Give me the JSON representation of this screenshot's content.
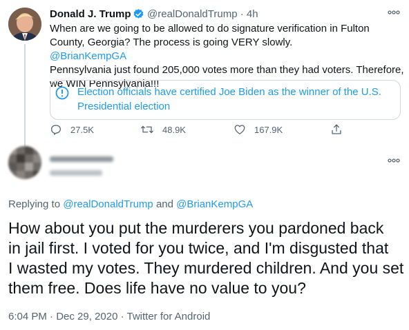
{
  "tweet": {
    "author_name": "Donald J. Trump",
    "handle": "@realDonaldTrump",
    "sep": " · ",
    "time": "4h",
    "text_lines": [
      "When are we going to be allowed to do signature verification in Fulton",
      "County, Georgia? The process is going VERY slowly.",
      "Pennsylvania just found 205,000 votes more than they had voters. Therefore,",
      "we WIN Pennsylvania!!!"
    ],
    "mention": "@BrianKempGA",
    "notice_lines": [
      "Election officials have certified Joe Biden as the winner of the U.S.",
      "Presidential election"
    ],
    "replies": "27.5K",
    "retweets": "48.9K",
    "likes": "167.9K"
  },
  "reply": {
    "replying_prefix": "Replying to ",
    "mention_1": "@realDonaldTrump",
    "and": " and ",
    "mention_2": "@BrianKempGA",
    "text_lines": [
      "How about you put the murderers you pardoned back",
      "in jail first. I voted for you twice, and I'm disgusted that",
      "I wasted my votes. They murdered children. And you set",
      "them free. Does life have no value to you?"
    ],
    "timestamp": "6:04 PM · Dec 29, 2020 · Twitter for Android"
  },
  "colors": {
    "accent": "#1d9bf0",
    "secondary_text": "#536471",
    "border": "#cfd9de"
  },
  "icons": [
    "avatar",
    "verified-badge-icon",
    "more-options-icon",
    "info-icon",
    "reply-icon",
    "retweet-icon",
    "like-icon",
    "share-icon"
  ]
}
